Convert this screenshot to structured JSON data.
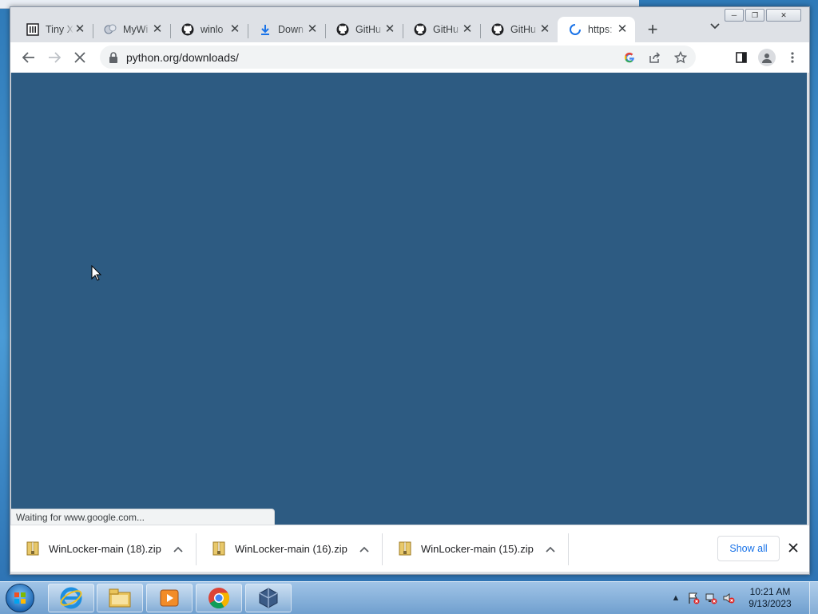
{
  "browser": {
    "tabs": [
      {
        "title": "Tiny X",
        "icon": "museum-icon"
      },
      {
        "title": "MyWi",
        "icon": "mywi-icon"
      },
      {
        "title": "winlo",
        "icon": "github-icon"
      },
      {
        "title": "Down",
        "icon": "download-icon"
      },
      {
        "title": "GitHu",
        "icon": "github-icon"
      },
      {
        "title": "GitHu",
        "icon": "github-icon"
      },
      {
        "title": "GitHu",
        "icon": "github-icon"
      },
      {
        "title": "https:",
        "icon": "loading-spinner-icon",
        "active": true
      }
    ],
    "address": {
      "url": "python.org/downloads/"
    },
    "status_text": "Waiting for www.google.com...",
    "content_color": "#2d5b82"
  },
  "downloads": {
    "items": [
      {
        "name": "WinLocker-main (18).zip"
      },
      {
        "name": "WinLocker-main (16).zip"
      },
      {
        "name": "WinLocker-main (15).zip"
      }
    ],
    "show_all_label": "Show all"
  },
  "taskbar": {
    "apps": [
      "internet-explorer-icon",
      "file-explorer-icon",
      "media-player-icon",
      "chrome-icon",
      "virtualbox-icon"
    ],
    "clock": {
      "time": "10:21 AM",
      "date": "9/13/2023"
    }
  }
}
